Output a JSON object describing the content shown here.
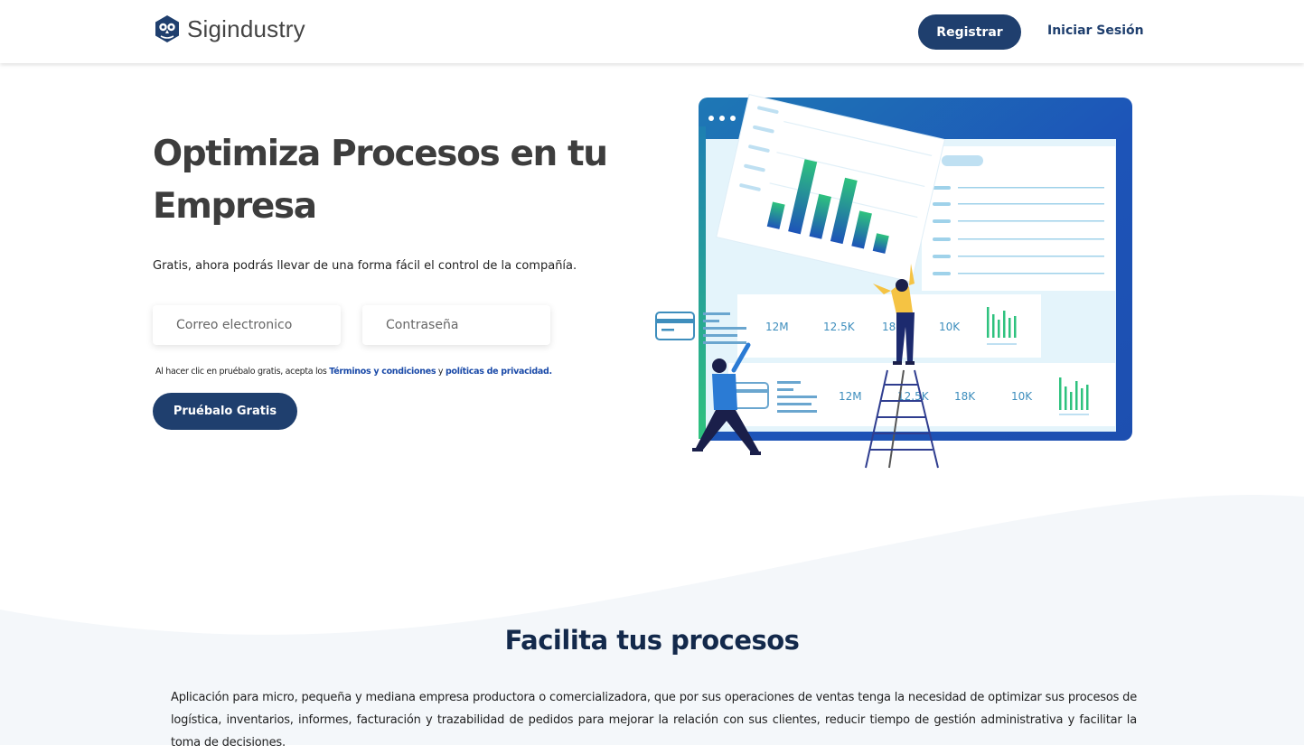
{
  "header": {
    "brand_name": "Sigindustry",
    "register_label": "Registrar",
    "login_label": "Iniciar Sesión"
  },
  "hero": {
    "title": "Optimiza Procesos en tu Empresa",
    "subtitle": "Gratis, ahora podrás llevar de una forma fácil el control de la compañía.",
    "email_placeholder": "Correo electronico",
    "password_placeholder": "Contraseña",
    "legal_prefix": "Al hacer clic en pruébalo gratis, acepta los ",
    "terms_label": "Términos y condiciones",
    "legal_and": " y ",
    "privacy_label": "políticas de privacidad.",
    "trial_label": "Pruébalo Gratis"
  },
  "illustration": {
    "row1": [
      "12M",
      "12.5K",
      "18K",
      "10K"
    ],
    "row2": [
      "12M",
      "12.5K",
      "18K",
      "10K"
    ]
  },
  "features": {
    "title": "Facilita tus procesos",
    "text": "Aplicación para micro, pequeña y mediana empresa productora o comercializadora, que por sus operaciones de ventas tenga la necesidad de optimizar sus procesos de logística, inventarios, informes, facturación y trazabilidad de pedidos para mejorar la relación con sus clientes, reducir tiempo de gestión administrativa y facilitar la toma de decisiones."
  },
  "colors": {
    "primary": "#1f3f6e",
    "link": "#1a4aa8",
    "illustration_blue": "#1e56b8",
    "illustration_green": "#2ec27e"
  }
}
